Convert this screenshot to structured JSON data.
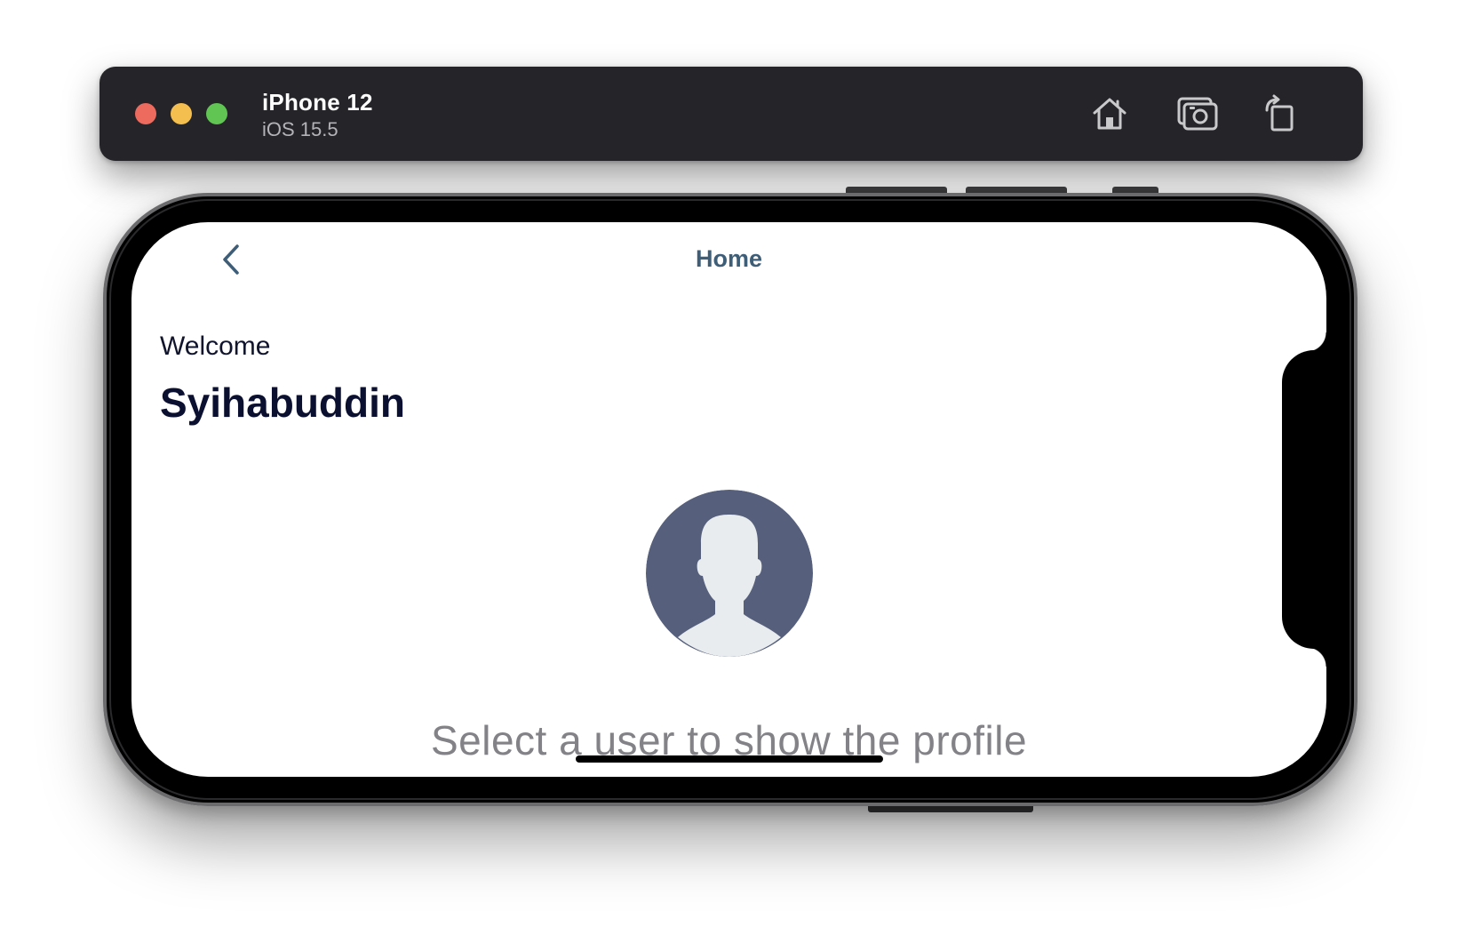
{
  "simulator": {
    "device_name": "iPhone 12",
    "os_version": "iOS 15.5",
    "buttons": {
      "home": "home-icon",
      "screenshot": "camera-icon",
      "rotate": "rotate-icon"
    },
    "traffic_lights": {
      "close": "#ed6a5e",
      "minimize": "#f4bf4f",
      "zoom": "#61c554"
    }
  },
  "app": {
    "nav": {
      "title": "Home",
      "back_icon": "chevron-left-icon",
      "accent_color": "#3e5e78"
    },
    "welcome_label": "Welcome",
    "user_name": "Syihabuddin",
    "avatar": {
      "icon": "default-avatar-icon",
      "background_color": "#56607d",
      "silhouette_color": "#e8ecee"
    },
    "hint": "Select a user to show the profile"
  }
}
